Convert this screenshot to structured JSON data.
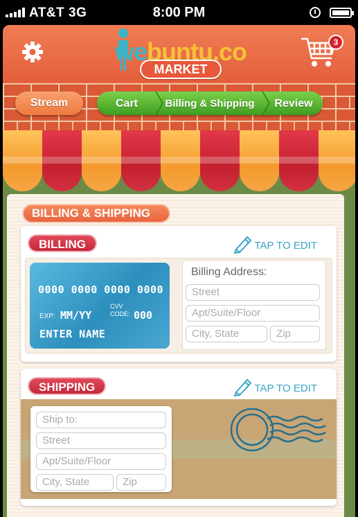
{
  "status_bar": {
    "carrier": "AT&T",
    "network": "3G",
    "time": "8:00 PM"
  },
  "header": {
    "logo_prefix": "we",
    "logo_suffix": "buntu.co",
    "market_label": "MARKET",
    "cart_count": "3"
  },
  "tabs": {
    "stream": "Stream",
    "steps": [
      "Cart",
      "Billing & Shipping",
      "Review"
    ],
    "active_step": "Billing & Shipping"
  },
  "section_title": "BILLING & SHIPPING",
  "billing": {
    "label": "BILLING",
    "tap_to_edit": "TAP TO EDIT",
    "card": {
      "number": "0000 0000 0000 0000",
      "exp_label": "EXP:",
      "exp_value": "MM/YY",
      "cvv_label_line1": "CVV",
      "cvv_label_line2": "CODE:",
      "cvv_value": "000",
      "name": "ENTER NAME"
    },
    "address": {
      "title": "Billing Address:",
      "street": "Street",
      "apt": "Apt/Suite/Floor",
      "city_state": "City, State",
      "zip": "Zip"
    }
  },
  "shipping": {
    "label": "SHIPPING",
    "tap_to_edit": "TAP TO EDIT",
    "ship_to": "Ship to:",
    "street": "Street",
    "apt": "Apt/Suite/Floor",
    "city_state": "City, State",
    "zip": "Zip"
  },
  "colors": {
    "header": "#e8653f",
    "brick": "#d95a35",
    "green_step": "#4fae28",
    "accent_blue": "#3aa5c8",
    "billing_red": "#c5283a"
  }
}
